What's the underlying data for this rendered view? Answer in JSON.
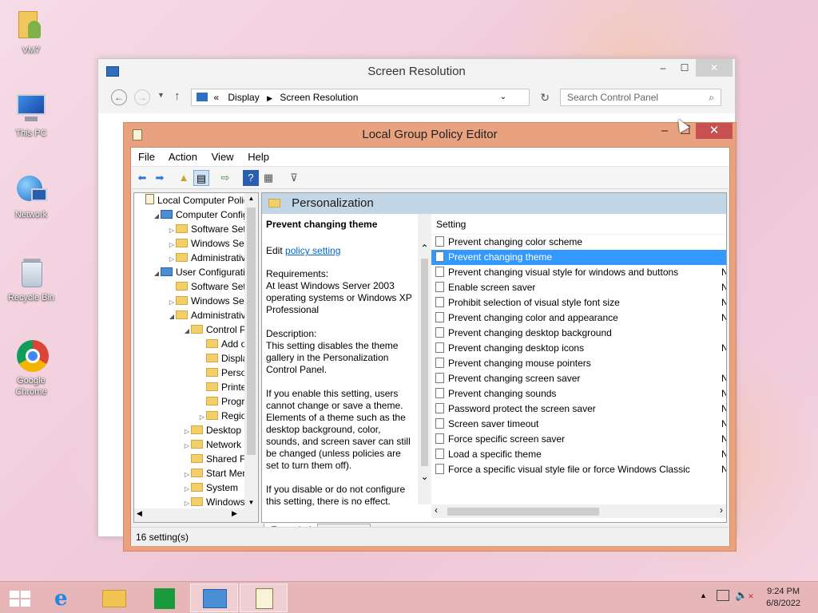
{
  "desktop_icons": [
    {
      "label": "VM7"
    },
    {
      "label": "This PC"
    },
    {
      "label": "Network"
    },
    {
      "label": "Recycle Bin"
    },
    {
      "label": "Google Chrome"
    }
  ],
  "screen_resolution": {
    "title": "Screen Resolution",
    "address": {
      "prefix": "«",
      "crumbs": [
        "Display",
        "Screen Resolution"
      ]
    },
    "search_placeholder": "Search Control Panel"
  },
  "gpedit": {
    "title": "Local Group Policy Editor",
    "menu": [
      "File",
      "Action",
      "View",
      "Help"
    ],
    "tree": [
      {
        "label": "Local Computer Polic",
        "exp": ""
      },
      {
        "label": "Computer Config",
        "exp": "◢"
      },
      {
        "label": "Software Setti",
        "exp": "▷"
      },
      {
        "label": "Windows Sett",
        "exp": "▷"
      },
      {
        "label": "Administrative",
        "exp": "▷"
      },
      {
        "label": "User Configuration",
        "exp": "◢"
      },
      {
        "label": "Software Setti",
        "exp": ""
      },
      {
        "label": "Windows Sett",
        "exp": "▷"
      },
      {
        "label": "Administrative",
        "exp": "◢"
      },
      {
        "label": "Control Pa",
        "exp": "◢"
      },
      {
        "label": "Add or",
        "exp": ""
      },
      {
        "label": "Display",
        "exp": ""
      },
      {
        "label": "Person",
        "exp": ""
      },
      {
        "label": "Printer",
        "exp": ""
      },
      {
        "label": "Progra",
        "exp": ""
      },
      {
        "label": "Region",
        "exp": "▷"
      },
      {
        "label": "Desktop",
        "exp": "▷"
      },
      {
        "label": "Network",
        "exp": "▷"
      },
      {
        "label": "Shared Fol",
        "exp": ""
      },
      {
        "label": "Start Menu",
        "exp": "▷"
      },
      {
        "label": "System",
        "exp": "▷"
      },
      {
        "label": "Windows C",
        "exp": "▷"
      }
    ],
    "pane_header": "Personalization",
    "description": {
      "title": "Prevent changing theme",
      "edit_prefix": "Edit ",
      "edit_link": "policy setting",
      "requirements_label": "Requirements:",
      "requirements": "At least Windows Server 2003 operating systems or Windows XP Professional",
      "description_label": "Description:",
      "description": "This setting disables the theme gallery in the Personalization Control Panel.",
      "enable_text": "If you enable this setting, users cannot change or save a theme. Elements of a theme such as the desktop background, color, sounds, and screen saver can still be changed (unless policies are set to turn them off).",
      "disable_text": "If you disable or do not configure this setting, there is no effect."
    },
    "list_header": "Setting",
    "settings": [
      {
        "name": "Prevent changing color scheme",
        "state": ""
      },
      {
        "name": "Prevent changing theme",
        "state": ""
      },
      {
        "name": "Prevent changing visual style for windows and buttons",
        "state": "N"
      },
      {
        "name": "Enable screen saver",
        "state": "N"
      },
      {
        "name": "Prohibit selection of visual style font size",
        "state": "N"
      },
      {
        "name": "Prevent changing color and appearance",
        "state": "N"
      },
      {
        "name": "Prevent changing desktop background",
        "state": ""
      },
      {
        "name": "Prevent changing desktop icons",
        "state": "N"
      },
      {
        "name": "Prevent changing mouse pointers",
        "state": ""
      },
      {
        "name": "Prevent changing screen saver",
        "state": "N"
      },
      {
        "name": "Prevent changing sounds",
        "state": "N"
      },
      {
        "name": "Password protect the screen saver",
        "state": "N"
      },
      {
        "name": "Screen saver timeout",
        "state": "N"
      },
      {
        "name": "Force specific screen saver",
        "state": "N"
      },
      {
        "name": "Load a specific theme",
        "state": "N"
      },
      {
        "name": "Force a specific visual style file or force Windows Classic",
        "state": "N"
      }
    ],
    "selected_index": 1,
    "tabs": [
      "Extended",
      "Standard"
    ],
    "status": "16 setting(s)"
  },
  "taskbar": {
    "time": "9:24 PM",
    "date": "6/8/2022"
  },
  "colors": {
    "accent_selection": "#3399ff",
    "gp_frame": "#e9a280",
    "close_button": "#c75050"
  }
}
